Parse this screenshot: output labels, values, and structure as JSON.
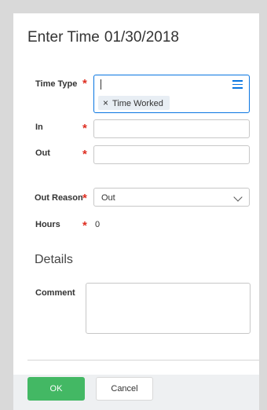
{
  "dialog": {
    "title": "Enter Time",
    "date": "01/30/2018"
  },
  "required_marker": "*",
  "fields": {
    "time_type": {
      "label": "Time Type",
      "value": "",
      "selected_pill": "Time Worked",
      "pill_remove_glyph": "×",
      "icon": "list-icon"
    },
    "in": {
      "label": "In",
      "value": ""
    },
    "out": {
      "label": "Out",
      "value": ""
    },
    "out_reason": {
      "label": "Out Reason",
      "value": "Out",
      "icon": "chevron-down-icon"
    },
    "hours": {
      "label": "Hours",
      "value": "0"
    }
  },
  "details": {
    "heading": "Details",
    "comment_label": "Comment",
    "comment_value": ""
  },
  "footer": {
    "ok_label": "OK",
    "cancel_label": "Cancel"
  },
  "colors": {
    "required": "#de2e21",
    "focus_border": "#0875e1",
    "ok_button": "#43b864",
    "pill_bg": "#e8eef4"
  }
}
